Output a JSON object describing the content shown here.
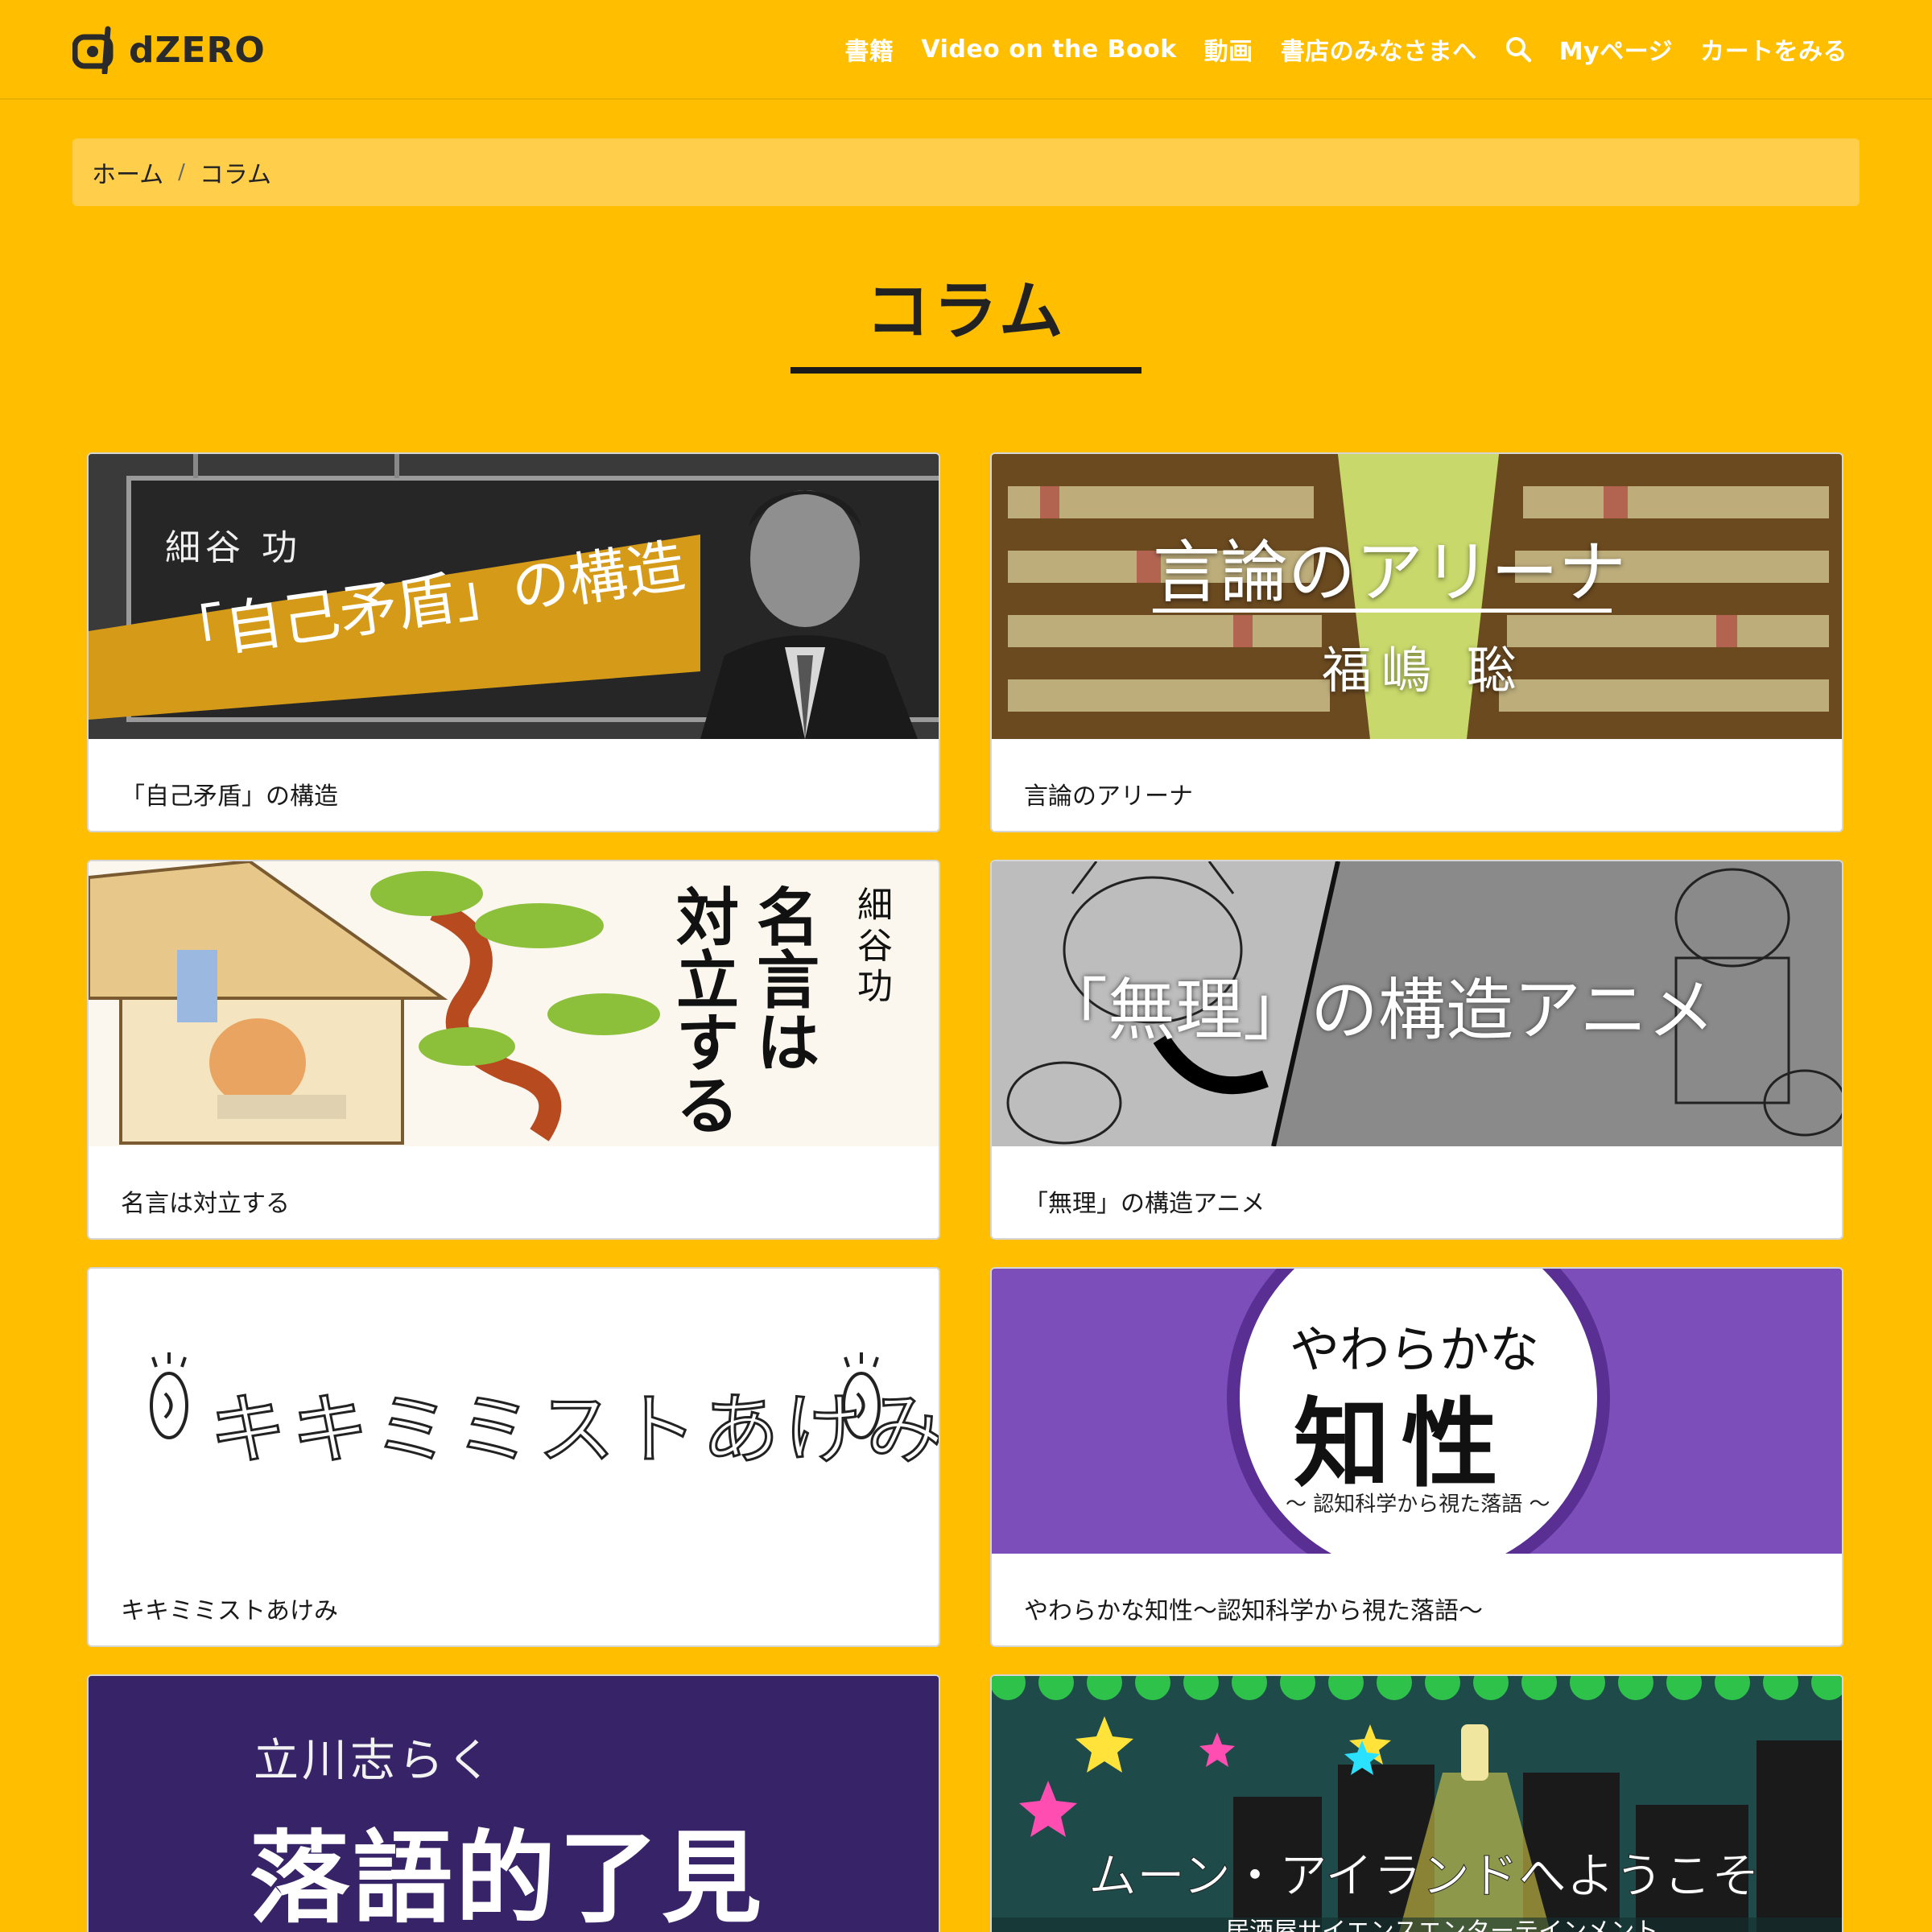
{
  "header": {
    "logo_text": "dZERO",
    "nav": [
      "書籍",
      "Video on the Book",
      "動画",
      "書店のみなさまへ",
      "Myページ",
      "カートをみる"
    ]
  },
  "breadcrumb": {
    "home": "ホーム",
    "sep": "/",
    "current": "コラム"
  },
  "page": {
    "title": "コラム"
  },
  "colors": {
    "background": "#FFBF00",
    "breadcrumb_bg": "#FFCF4C",
    "card_bg": "#FFFFFF"
  },
  "cards": [
    {
      "label": "「自己矛盾」の構造",
      "thumb": {
        "author": "細谷 功",
        "headline": "「自己矛盾」の構造"
      }
    },
    {
      "label": "言論のアリーナ",
      "thumb": {
        "headline": "言論のアリーナ",
        "author": "福嶋 聡"
      }
    },
    {
      "label": "名言は対立する",
      "thumb": {
        "author": "細谷 功",
        "headline_col1": "名言は",
        "headline_col2": "対立する"
      }
    },
    {
      "label": "「無理」の構造アニメ",
      "thumb": {
        "headline": "「無理」の構造アニメ"
      }
    },
    {
      "label": "キキミミストあけみ",
      "thumb": {
        "headline": "キキミミストあけみ"
      }
    },
    {
      "label": "やわらかな知性〜認知科学から視た落語〜",
      "thumb": {
        "headline_top": "やわらかな",
        "headline_main": "知性",
        "sub": "〜 認知科学から視た落語 〜"
      }
    },
    {
      "label": "",
      "thumb": {
        "author": "立川志らく",
        "headline": "落語的了見"
      }
    },
    {
      "label": "",
      "thumb": {
        "headline": "ムーン・アイランドへようこそ",
        "sub": "居酒屋サイエンスエンターテインメント"
      }
    }
  ]
}
